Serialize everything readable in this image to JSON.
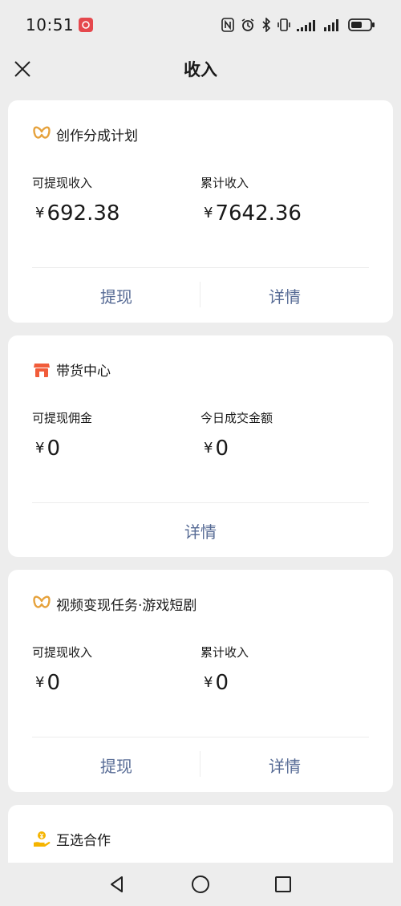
{
  "status_bar": {
    "time": "10:51"
  },
  "header": {
    "title": "收入"
  },
  "cards": [
    {
      "title": "创作分成计划",
      "icon": "butterfly-icon",
      "left_label": "可提现收入",
      "left_value": "692.38",
      "right_label": "累计收入",
      "right_value": "7642.36",
      "button_withdraw": "提现",
      "button_detail": "详情"
    },
    {
      "title": "带货中心",
      "icon": "shop-icon",
      "left_label": "可提现佣金",
      "left_value": "0",
      "right_label": "今日成交金额",
      "right_value": "0",
      "button_detail": "详情"
    },
    {
      "title": "视频变现任务·游戏短剧",
      "icon": "butterfly-icon",
      "left_label": "可提现收入",
      "left_value": "0",
      "right_label": "累计收入",
      "right_value": "0",
      "button_withdraw": "提现",
      "button_detail": "详情"
    },
    {
      "title": "互选合作",
      "icon": "hand-coin-icon"
    }
  ],
  "currency_symbol": "¥",
  "colors": {
    "link": "#576b95",
    "butterfly": "#e6a23c",
    "shop": "#f15c3a",
    "hand_coin": "#f5b400"
  }
}
